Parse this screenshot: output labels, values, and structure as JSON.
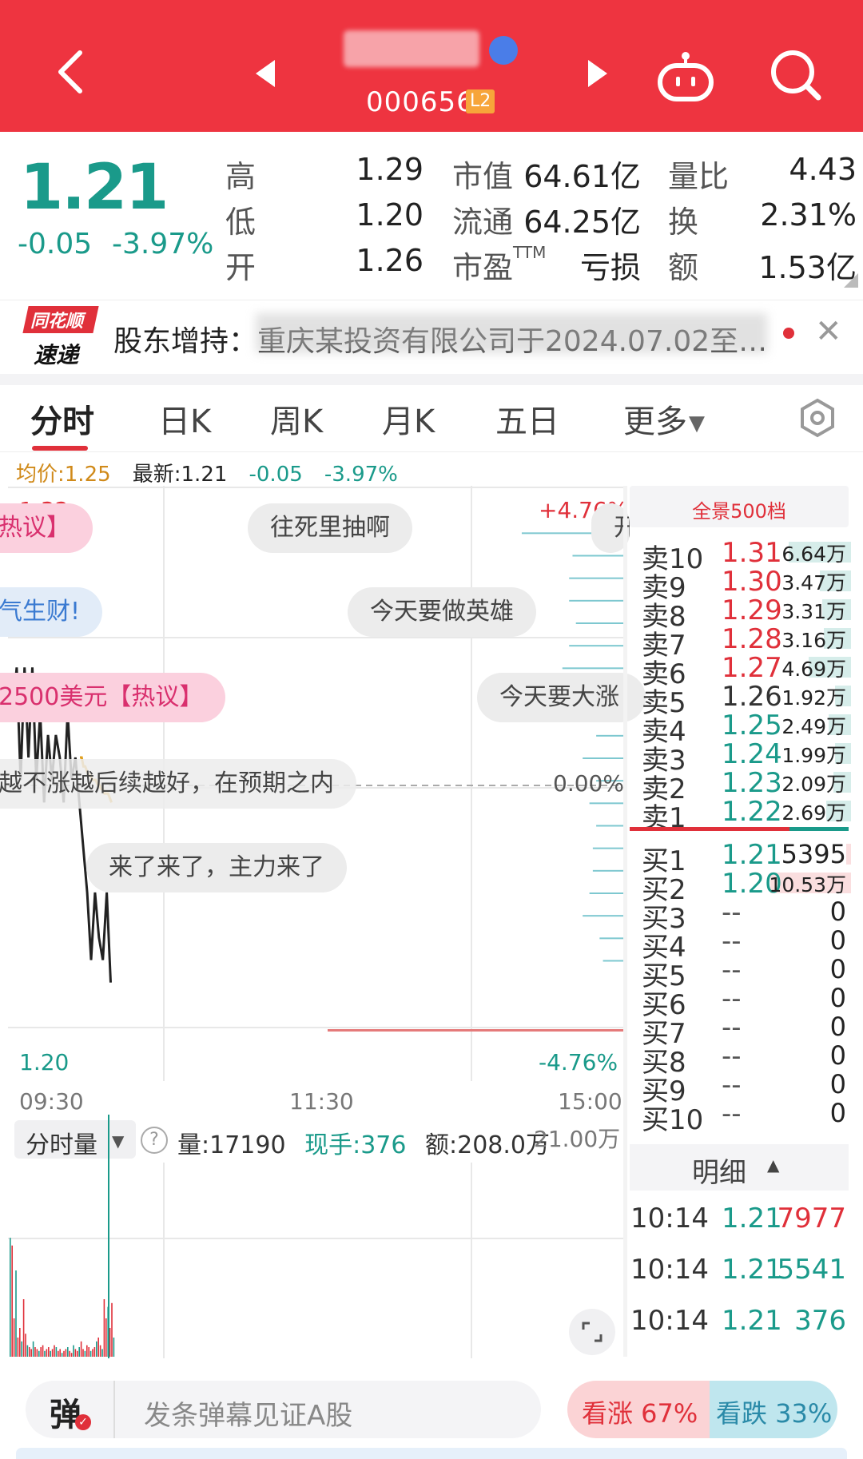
{
  "header": {
    "code": "000656",
    "level_badge": "L2",
    "accent": "#ee3440"
  },
  "quote": {
    "price": "1.21",
    "change": "-0.05",
    "change_pct": "-3.97%",
    "stats": [
      {
        "label": "高",
        "value": "1.29",
        "color": "#e0303a"
      },
      {
        "label": "低",
        "value": "1.20",
        "color": "#1a9a8a"
      },
      {
        "label": "开",
        "value": "1.26",
        "color": "#222222"
      }
    ],
    "market": [
      {
        "label": "市值",
        "value": "64.61亿"
      },
      {
        "label": "流通",
        "value": "64.25亿"
      },
      {
        "label": "市盈TTM",
        "value": "亏损"
      }
    ],
    "extra": [
      {
        "label": "量比",
        "value": "4.43",
        "color": "#e0303a"
      },
      {
        "label": "换",
        "value": "2.31%",
        "color": "#222222"
      },
      {
        "label": "额",
        "value": "1.53亿",
        "color": "#222222"
      }
    ]
  },
  "news": {
    "source_top": "同花顺",
    "source_bottom": "速递",
    "text": "股东增持：重庆某投资有限公司于2024.07.02至…"
  },
  "tabs": [
    "分时",
    "日K",
    "周K",
    "月K",
    "五日",
    "更多"
  ],
  "info": {
    "avg_label": "均价:1.25",
    "latest_label": "最新:1.21",
    "chg": "-0.05",
    "chg_pct": "-3.97%"
  },
  "chart": {
    "y_top": "1.32",
    "y_bottom": "1.20",
    "pct_top": "+4.76%",
    "pct_mid": "0.00%",
    "pct_bottom": "-4.76%",
    "time_start": "09:30",
    "time_mid": "11:30",
    "time_end": "15:00"
  },
  "danmu": [
    "热议】",
    "往死里抽啊",
    "开",
    "气生财!",
    "今天要做英雄",
    "2500美元【热议】",
    "今天要大涨",
    "越不涨越后续越好，在预期之内",
    "来了来了，主力来了"
  ],
  "chart_data": {
    "type": "line",
    "title": "",
    "ylim": [
      1.2,
      1.32
    ],
    "series": [
      {
        "values": [
          1.27,
          1.28,
          1.255,
          1.28,
          1.26,
          1.28,
          1.255,
          1.27,
          1.25,
          1.265,
          1.255,
          1.265,
          1.26,
          1.25,
          1.27,
          1.255,
          1.26,
          1.25,
          1.24,
          1.23,
          1.215,
          1.23,
          1.22,
          1.215,
          1.23,
          1.21
        ]
      },
      {
        "values": [
          1.26,
          1.26,
          1.258,
          1.258,
          1.257,
          1.256,
          1.256,
          1.255,
          1.255,
          1.255,
          1.254,
          1.254,
          1.253,
          1.253,
          1.252,
          1.252,
          1.252,
          1.251,
          1.25
        ]
      }
    ]
  },
  "order_book": {
    "title": "全景500档",
    "asks": [
      {
        "label": "卖10",
        "price": "1.31",
        "vol": "6.64万",
        "bar": 0.28
      },
      {
        "label": "卖9",
        "price": "1.30",
        "vol": "3.47万",
        "bar": 0.14
      },
      {
        "label": "卖8",
        "price": "1.29",
        "vol": "3.31万",
        "bar": 0.13
      },
      {
        "label": "卖7",
        "price": "1.28",
        "vol": "3.16万",
        "bar": 0.12
      },
      {
        "label": "卖6",
        "price": "1.27",
        "vol": "4.69万",
        "bar": 0.19
      },
      {
        "label": "卖5",
        "price": "1.26",
        "vol": "1.92万",
        "bar": 0.07
      },
      {
        "label": "卖4",
        "price": "1.25",
        "vol": "2.49万",
        "bar": 0.1
      },
      {
        "label": "卖3",
        "price": "1.24",
        "vol": "1.99万",
        "bar": 0.07
      },
      {
        "label": "卖2",
        "price": "1.23",
        "vol": "2.09万",
        "bar": 0.08
      },
      {
        "label": "卖1",
        "price": "1.22",
        "vol": "2.69万",
        "bar": 0.11
      }
    ],
    "bids": [
      {
        "label": "买1",
        "price": "1.21",
        "vol": "5395",
        "bar": 0.02
      },
      {
        "label": "买2",
        "price": "1.20",
        "vol": "10.53万",
        "bar": 0.36
      },
      {
        "label": "买3",
        "price": "--",
        "vol": "0",
        "bar": 0
      },
      {
        "label": "买4",
        "price": "--",
        "vol": "0",
        "bar": 0
      },
      {
        "label": "买5",
        "price": "--",
        "vol": "0",
        "bar": 0
      },
      {
        "label": "买6",
        "price": "--",
        "vol": "0",
        "bar": 0
      },
      {
        "label": "买7",
        "price": "--",
        "vol": "0",
        "bar": 0
      },
      {
        "label": "买8",
        "price": "--",
        "vol": "0",
        "bar": 0
      },
      {
        "label": "买9",
        "price": "--",
        "vol": "0",
        "bar": 0
      },
      {
        "label": "买10",
        "price": "--",
        "vol": "0",
        "bar": 0
      }
    ]
  },
  "detail": {
    "title": "明细",
    "rows": [
      {
        "time": "10:14",
        "price": "1.21",
        "vol": "7977"
      },
      {
        "time": "10:14",
        "price": "1.21",
        "vol": "5541"
      },
      {
        "time": "10:14",
        "price": "1.21",
        "vol": "376"
      }
    ]
  },
  "volume": {
    "selector": "分时量",
    "vol": "量:17190",
    "hand": "现手:376",
    "amount": "额:208.0万",
    "max": "21.00万"
  },
  "bottom": {
    "danmu_icon": "弹",
    "placeholder": "发条弹幕见证A股",
    "up": "看涨 67%",
    "down": "看跌 33%",
    "up_ratio": 0.67
  }
}
